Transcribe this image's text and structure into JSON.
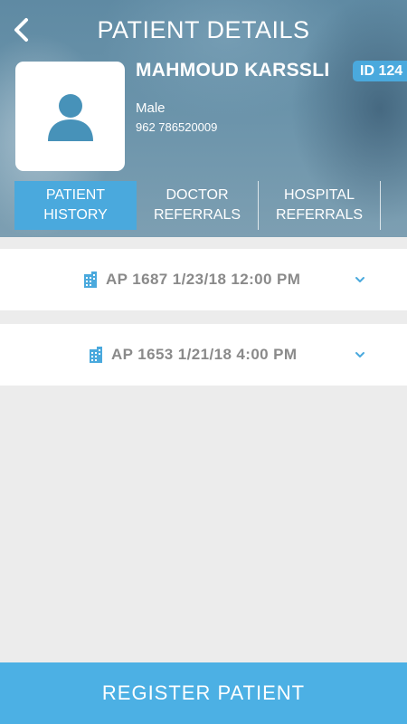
{
  "header": {
    "title": "PATIENT DETAILS",
    "back_icon": "chevron-left-icon"
  },
  "patient": {
    "name": "MAHMOUD KARSSLI",
    "id_badge": "ID 124",
    "gender": "Male",
    "phone": "962 786520009",
    "avatar_icon": "user-icon"
  },
  "tabs": [
    {
      "label": "PATIENT\nHISTORY",
      "active": true
    },
    {
      "label": "DOCTOR\nREFERRALS",
      "active": false
    },
    {
      "label": "HOSPITAL\nREFERRALS",
      "active": false
    }
  ],
  "appointments": [
    {
      "label": "AP 1687 1/23/18 12:00 PM",
      "icon": "hospital-building-icon"
    },
    {
      "label": "AP 1653 1/21/18 4:00 PM",
      "icon": "hospital-building-icon"
    }
  ],
  "footer": {
    "register_label": "REGISTER PATIENT"
  },
  "colors": {
    "accent": "#4aa9dd",
    "muted_text": "#8a8a8a",
    "background": "#ececec"
  }
}
